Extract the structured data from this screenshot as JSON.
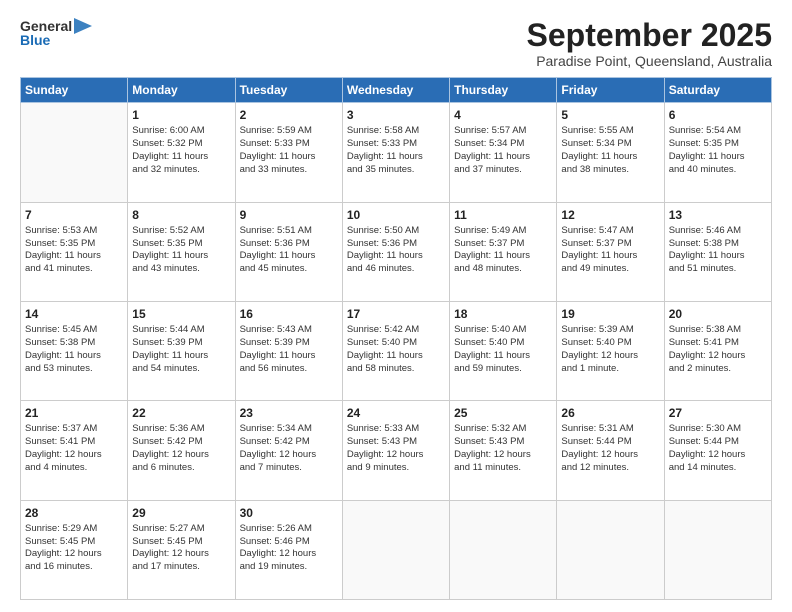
{
  "logo": {
    "general": "General",
    "blue": "Blue"
  },
  "header": {
    "month": "September 2025",
    "location": "Paradise Point, Queensland, Australia"
  },
  "days_of_week": [
    "Sunday",
    "Monday",
    "Tuesday",
    "Wednesday",
    "Thursday",
    "Friday",
    "Saturday"
  ],
  "weeks": [
    [
      {
        "day": "",
        "info": ""
      },
      {
        "day": "1",
        "info": "Sunrise: 6:00 AM\nSunset: 5:32 PM\nDaylight: 11 hours\nand 32 minutes."
      },
      {
        "day": "2",
        "info": "Sunrise: 5:59 AM\nSunset: 5:33 PM\nDaylight: 11 hours\nand 33 minutes."
      },
      {
        "day": "3",
        "info": "Sunrise: 5:58 AM\nSunset: 5:33 PM\nDaylight: 11 hours\nand 35 minutes."
      },
      {
        "day": "4",
        "info": "Sunrise: 5:57 AM\nSunset: 5:34 PM\nDaylight: 11 hours\nand 37 minutes."
      },
      {
        "day": "5",
        "info": "Sunrise: 5:55 AM\nSunset: 5:34 PM\nDaylight: 11 hours\nand 38 minutes."
      },
      {
        "day": "6",
        "info": "Sunrise: 5:54 AM\nSunset: 5:35 PM\nDaylight: 11 hours\nand 40 minutes."
      }
    ],
    [
      {
        "day": "7",
        "info": "Sunrise: 5:53 AM\nSunset: 5:35 PM\nDaylight: 11 hours\nand 41 minutes."
      },
      {
        "day": "8",
        "info": "Sunrise: 5:52 AM\nSunset: 5:35 PM\nDaylight: 11 hours\nand 43 minutes."
      },
      {
        "day": "9",
        "info": "Sunrise: 5:51 AM\nSunset: 5:36 PM\nDaylight: 11 hours\nand 45 minutes."
      },
      {
        "day": "10",
        "info": "Sunrise: 5:50 AM\nSunset: 5:36 PM\nDaylight: 11 hours\nand 46 minutes."
      },
      {
        "day": "11",
        "info": "Sunrise: 5:49 AM\nSunset: 5:37 PM\nDaylight: 11 hours\nand 48 minutes."
      },
      {
        "day": "12",
        "info": "Sunrise: 5:47 AM\nSunset: 5:37 PM\nDaylight: 11 hours\nand 49 minutes."
      },
      {
        "day": "13",
        "info": "Sunrise: 5:46 AM\nSunset: 5:38 PM\nDaylight: 11 hours\nand 51 minutes."
      }
    ],
    [
      {
        "day": "14",
        "info": "Sunrise: 5:45 AM\nSunset: 5:38 PM\nDaylight: 11 hours\nand 53 minutes."
      },
      {
        "day": "15",
        "info": "Sunrise: 5:44 AM\nSunset: 5:39 PM\nDaylight: 11 hours\nand 54 minutes."
      },
      {
        "day": "16",
        "info": "Sunrise: 5:43 AM\nSunset: 5:39 PM\nDaylight: 11 hours\nand 56 minutes."
      },
      {
        "day": "17",
        "info": "Sunrise: 5:42 AM\nSunset: 5:40 PM\nDaylight: 11 hours\nand 58 minutes."
      },
      {
        "day": "18",
        "info": "Sunrise: 5:40 AM\nSunset: 5:40 PM\nDaylight: 11 hours\nand 59 minutes."
      },
      {
        "day": "19",
        "info": "Sunrise: 5:39 AM\nSunset: 5:40 PM\nDaylight: 12 hours\nand 1 minute."
      },
      {
        "day": "20",
        "info": "Sunrise: 5:38 AM\nSunset: 5:41 PM\nDaylight: 12 hours\nand 2 minutes."
      }
    ],
    [
      {
        "day": "21",
        "info": "Sunrise: 5:37 AM\nSunset: 5:41 PM\nDaylight: 12 hours\nand 4 minutes."
      },
      {
        "day": "22",
        "info": "Sunrise: 5:36 AM\nSunset: 5:42 PM\nDaylight: 12 hours\nand 6 minutes."
      },
      {
        "day": "23",
        "info": "Sunrise: 5:34 AM\nSunset: 5:42 PM\nDaylight: 12 hours\nand 7 minutes."
      },
      {
        "day": "24",
        "info": "Sunrise: 5:33 AM\nSunset: 5:43 PM\nDaylight: 12 hours\nand 9 minutes."
      },
      {
        "day": "25",
        "info": "Sunrise: 5:32 AM\nSunset: 5:43 PM\nDaylight: 12 hours\nand 11 minutes."
      },
      {
        "day": "26",
        "info": "Sunrise: 5:31 AM\nSunset: 5:44 PM\nDaylight: 12 hours\nand 12 minutes."
      },
      {
        "day": "27",
        "info": "Sunrise: 5:30 AM\nSunset: 5:44 PM\nDaylight: 12 hours\nand 14 minutes."
      }
    ],
    [
      {
        "day": "28",
        "info": "Sunrise: 5:29 AM\nSunset: 5:45 PM\nDaylight: 12 hours\nand 16 minutes."
      },
      {
        "day": "29",
        "info": "Sunrise: 5:27 AM\nSunset: 5:45 PM\nDaylight: 12 hours\nand 17 minutes."
      },
      {
        "day": "30",
        "info": "Sunrise: 5:26 AM\nSunset: 5:46 PM\nDaylight: 12 hours\nand 19 minutes."
      },
      {
        "day": "",
        "info": ""
      },
      {
        "day": "",
        "info": ""
      },
      {
        "day": "",
        "info": ""
      },
      {
        "day": "",
        "info": ""
      }
    ]
  ]
}
